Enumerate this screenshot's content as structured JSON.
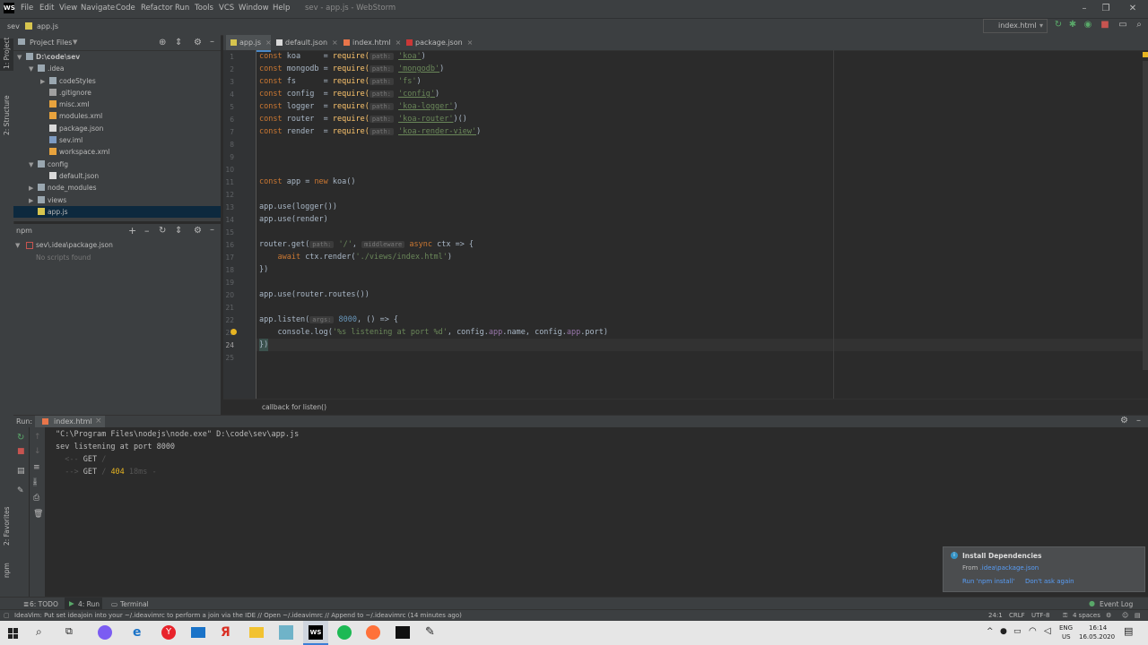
{
  "menu": {
    "items": [
      "File",
      "Edit",
      "View",
      "Navigate",
      "Code",
      "Refactor",
      "Run",
      "Tools",
      "VCS",
      "Window",
      "Help"
    ],
    "window_title": "sev - app.js - WebStorm"
  },
  "breadcrumb": {
    "project": "sev",
    "file": "app.js"
  },
  "toolbar": {
    "run_config": "index.html"
  },
  "left_stripe": {
    "project": "1: Project",
    "structure": "2: Structure",
    "favorites": "2: Favorites",
    "npm": "npm"
  },
  "project_panel": {
    "title": "Project Files",
    "tree": [
      {
        "label": "D:\\code\\sev",
        "indent": 0,
        "expanded": true,
        "type": "folder"
      },
      {
        "label": ".idea",
        "indent": 1,
        "expanded": true,
        "type": "folder"
      },
      {
        "label": "codeStyles",
        "indent": 2,
        "expanded": false,
        "type": "folder"
      },
      {
        "label": ".gitignore",
        "indent": 2,
        "type": "git"
      },
      {
        "label": "misc.xml",
        "indent": 2,
        "type": "xml"
      },
      {
        "label": "modules.xml",
        "indent": 2,
        "type": "xml"
      },
      {
        "label": "package.json",
        "indent": 2,
        "type": "json"
      },
      {
        "label": "sev.iml",
        "indent": 2,
        "type": "iml"
      },
      {
        "label": "workspace.xml",
        "indent": 2,
        "type": "xml"
      },
      {
        "label": "config",
        "indent": 1,
        "expanded": true,
        "type": "folder"
      },
      {
        "label": "default.json",
        "indent": 2,
        "type": "json"
      },
      {
        "label": "node_modules",
        "indent": 1,
        "expanded": false,
        "type": "folder"
      },
      {
        "label": "views",
        "indent": 1,
        "expanded": false,
        "type": "folder"
      },
      {
        "label": "app.js",
        "indent": 1,
        "type": "js",
        "selected": true
      }
    ]
  },
  "npm_panel": {
    "title": "npm",
    "package": "sev\\.idea\\package.json",
    "empty": "No scripts found"
  },
  "tabs": [
    {
      "label": "app.js",
      "active": true
    },
    {
      "label": "default.json",
      "active": false
    },
    {
      "label": "index.html",
      "active": false
    },
    {
      "label": "package.json",
      "active": false
    }
  ],
  "code": {
    "line_numbers": [
      "1",
      "2",
      "3",
      "4",
      "5",
      "6",
      "7",
      "8",
      "9",
      "10",
      "11",
      "12",
      "13",
      "14",
      "15",
      "16",
      "17",
      "18",
      "19",
      "20",
      "21",
      "22",
      "23",
      "24",
      "25"
    ],
    "hint_path": "path:",
    "hint_middleware": "middleware",
    "hint_args": "args:",
    "line1": {
      "a": "const ",
      "b": "koa     = ",
      "c": "require(",
      "d": "'koa'",
      "e": ")"
    },
    "line2": {
      "a": "const ",
      "b": "mongodb = ",
      "c": "require(",
      "d": "'mongodb'",
      "e": ")"
    },
    "line3": {
      "a": "const ",
      "b": "fs      = ",
      "c": "require(",
      "d": "'fs'",
      "e": ")"
    },
    "line4": {
      "a": "const ",
      "b": "config  = ",
      "c": "require(",
      "d": "'config'",
      "e": ")"
    },
    "line5": {
      "a": "const ",
      "b": "logger  = ",
      "c": "require(",
      "d": "'koa-logger'",
      "e": ")"
    },
    "line6": {
      "a": "const ",
      "b": "router  = ",
      "c": "require(",
      "d": "'koa-router'",
      "e": ")()"
    },
    "line7": {
      "a": "const ",
      "b": "render  = ",
      "c": "require(",
      "d": "'koa-render-view'",
      "e": ")"
    },
    "line11": {
      "a": "const ",
      "b": "app = ",
      "c": "new ",
      "d": "koa()"
    },
    "line13": "app.use(logger())",
    "line14": "app.use(render)",
    "line16": {
      "a": "router.get(",
      "b": "'/'",
      "c": ", ",
      "d": "async ",
      "e": "ctx => {"
    },
    "line17": {
      "a": "    await ",
      "b": "ctx.render(",
      "c": "'./views/index.html'",
      "d": ")"
    },
    "line18": "})",
    "line20": "app.use(router.routes())",
    "line22": {
      "a": "app.listen(",
      "b": "8000",
      "c": ", () => {"
    },
    "line23": {
      "a": "    console.log(",
      "b": "'%s listening at port %d'",
      "c": ", config.",
      "d": "app",
      "e": ".name, config.",
      "f": "app",
      "g": ".port)"
    },
    "line24": "})"
  },
  "editor_breadcrumb": "callback for listen()",
  "run_panel": {
    "label": "Run:",
    "tab": "index.html",
    "lines": [
      "\"C:\\Program Files\\nodejs\\node.exe\" D:\\code\\sev\\app.js",
      "sev listening at port 8000"
    ],
    "get1": {
      "arrow": "  <-- ",
      "method": "GET",
      "path": " /"
    },
    "get2": {
      "arrow": "  --> ",
      "method": "GET",
      "path": " / ",
      "status": "404",
      "time": " 18ms -"
    }
  },
  "bottom_tabs": {
    "todo": "6: TODO",
    "run": "4: Run",
    "terminal": "Terminal",
    "event_log": "Event Log"
  },
  "notification": {
    "title": "Install Dependencies",
    "from": "From",
    "from_link": ".idea\\package.json",
    "action1": "Run 'npm install'",
    "action2": "Don't ask again"
  },
  "status": {
    "message": "IdeaVim: Put set ideajoin into your ~/.ideavimrc to perform a join via the IDE // Open ~/.ideavimrc // Append to ~/.ideavimrc (14 minutes ago)",
    "position": "24:1",
    "line_sep": "CRLF",
    "encoding": "UTF-8",
    "indent": "4 spaces"
  },
  "taskbar": {
    "lang": "ENG",
    "region": "US",
    "time": "16:14",
    "date": "16.05.2020"
  }
}
